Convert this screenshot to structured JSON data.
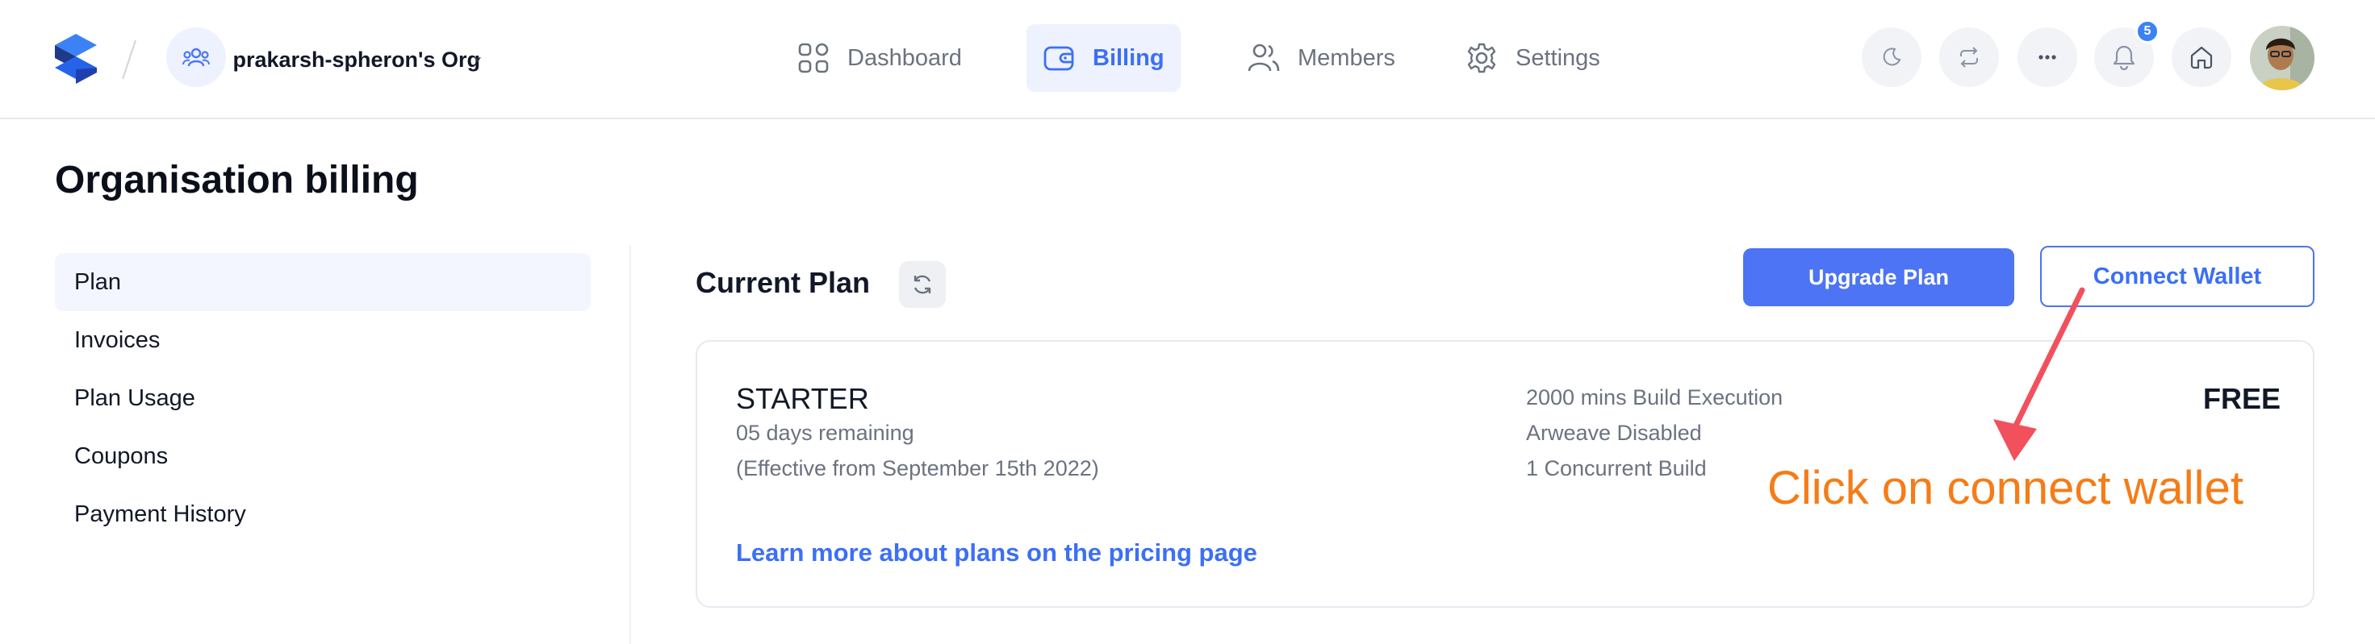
{
  "header": {
    "org_name": "prakarsh-spheron's Org",
    "nav": [
      {
        "label": "Dashboard",
        "icon": "grid-icon"
      },
      {
        "label": "Billing",
        "icon": "wallet-icon"
      },
      {
        "label": "Members",
        "icon": "users-icon"
      },
      {
        "label": "Settings",
        "icon": "gear-icon"
      }
    ],
    "active_nav": "Billing",
    "actions": [
      "moon-icon",
      "switch-icon",
      "more-icon",
      "bell-icon",
      "home-icon"
    ],
    "notification_count": "5"
  },
  "page": {
    "title": "Organisation billing",
    "sidebar": [
      {
        "label": "Plan"
      },
      {
        "label": "Invoices"
      },
      {
        "label": "Plan Usage"
      },
      {
        "label": "Coupons"
      },
      {
        "label": "Payment History"
      }
    ],
    "active_sidebar": "Plan"
  },
  "main": {
    "section_title": "Current Plan",
    "upgrade_label": "Upgrade Plan",
    "connect_wallet_label": "Connect Wallet",
    "plan": {
      "name": "STARTER",
      "days_remaining": "05 days remaining",
      "effective": "(Effective from September 15th 2022)",
      "features": [
        "2000 mins Build Execution",
        "Arweave Disabled",
        "1 Concurrent Build"
      ],
      "price": "FREE",
      "pricing_link": "Learn more about plans on the pricing page"
    }
  },
  "annotation": {
    "text": "Click on connect wallet",
    "color": "#f57c16",
    "arrow_color": "#f2505c"
  },
  "colors": {
    "accent": "#4c74f4",
    "active_bg": "#eef2ff",
    "muted_text": "#6b7280"
  }
}
